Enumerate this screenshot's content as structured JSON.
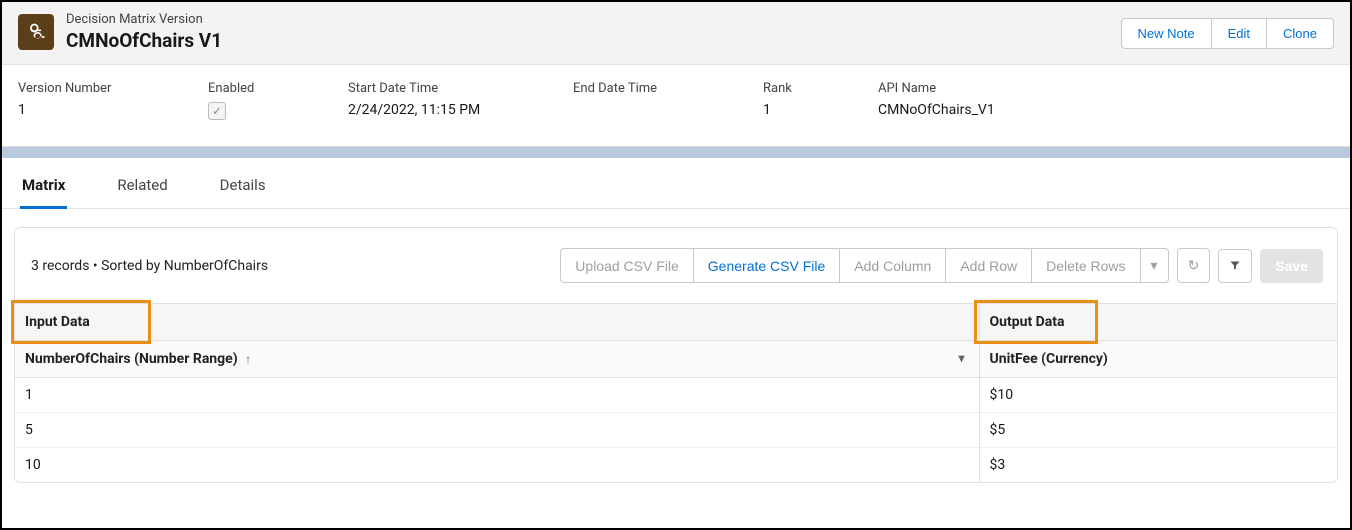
{
  "header": {
    "subtitle": "Decision Matrix Version",
    "title": "CMNoOfChairs V1",
    "actions": {
      "new_note": "New Note",
      "edit": "Edit",
      "clone": "Clone"
    }
  },
  "details": {
    "version_number": {
      "label": "Version Number",
      "value": "1"
    },
    "enabled": {
      "label": "Enabled",
      "value": true
    },
    "start_date_time": {
      "label": "Start Date Time",
      "value": "2/24/2022, 11:15 PM"
    },
    "end_date_time": {
      "label": "End Date Time",
      "value": ""
    },
    "rank": {
      "label": "Rank",
      "value": "1"
    },
    "api_name": {
      "label": "API Name",
      "value": "CMNoOfChairs_V1"
    }
  },
  "tabs": {
    "matrix": "Matrix",
    "related": "Related",
    "details": "Details"
  },
  "toolbar": {
    "records_text": "3 records • Sorted by NumberOfChairs",
    "upload_csv": "Upload CSV File",
    "generate_csv": "Generate CSV File",
    "add_column": "Add Column",
    "add_row": "Add Row",
    "delete_rows": "Delete Rows",
    "save": "Save"
  },
  "table": {
    "sections": {
      "input": "Input Data",
      "output": "Output Data"
    },
    "columns": {
      "input": "NumberOfChairs (Number Range)",
      "output": "UnitFee (Currency)"
    },
    "rows": [
      {
        "input": "1",
        "output": "$10"
      },
      {
        "input": "5",
        "output": "$5"
      },
      {
        "input": "10",
        "output": "$3"
      }
    ]
  }
}
